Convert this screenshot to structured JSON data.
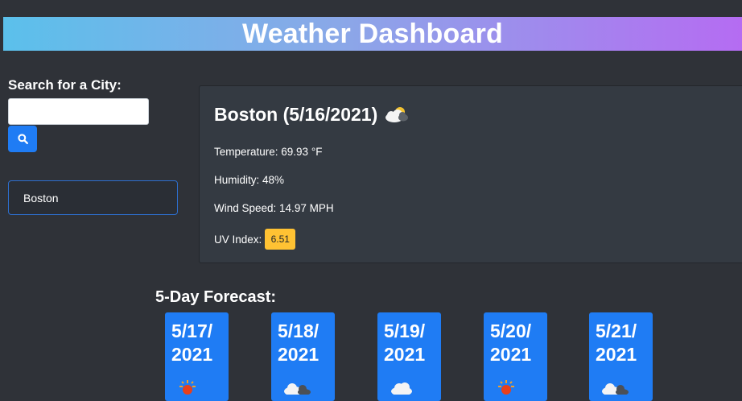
{
  "header": {
    "title": "Weather Dashboard"
  },
  "search": {
    "label": "Search for a City:",
    "value": "",
    "button_icon": "search-icon"
  },
  "history": [
    {
      "city": "Boston"
    }
  ],
  "current": {
    "title": "Boston (5/16/2021)",
    "icon": "partly-cloudy-icon",
    "temperature": "Temperature: 69.93 °F",
    "humidity": "Humidity: 48%",
    "wind": "Wind Speed: 14.97 MPH",
    "uv_label": "UV Index:",
    "uv_value": "6.51",
    "uv_color": "#ffc233"
  },
  "forecast": {
    "title": "5-Day Forecast:",
    "days": [
      {
        "date_line1": "5/17/",
        "date_line2": "2021",
        "icon": "sun-icon"
      },
      {
        "date_line1": "5/18/",
        "date_line2": "2021",
        "icon": "partly-cloudy-icon"
      },
      {
        "date_line1": "5/19/",
        "date_line2": "2021",
        "icon": "cloud-icon"
      },
      {
        "date_line1": "5/20/",
        "date_line2": "2021",
        "icon": "sun-icon"
      },
      {
        "date_line1": "5/21/",
        "date_line2": "2021",
        "icon": "partly-cloudy-icon"
      }
    ]
  },
  "colors": {
    "background": "#2f3238",
    "accent": "#1f7cf4",
    "panel": "#343a42"
  }
}
